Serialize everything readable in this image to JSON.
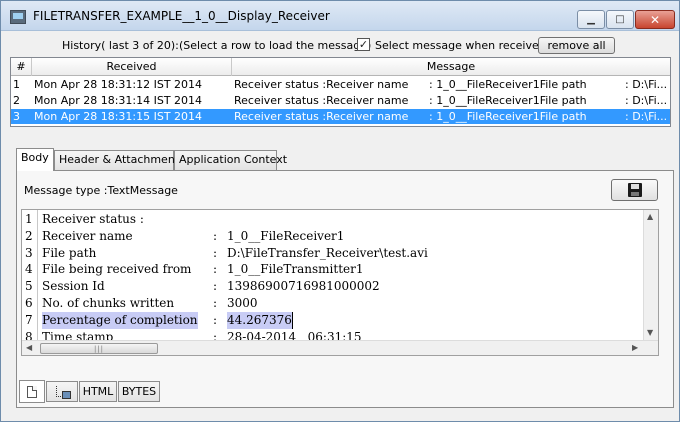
{
  "window": {
    "title": "FILETRANSFER_EXAMPLE__1_0__Display_Receiver",
    "controls": {
      "minimize": "▁",
      "maximize": "□",
      "close": "✕"
    }
  },
  "history": {
    "label": "History( last 3 of 20):",
    "hint": "(Select a row to load the message)",
    "checkbox_checked": true,
    "checkbox_mark": "✓",
    "checkbox_label": "Select message when received",
    "remove_all_label": "remove all"
  },
  "table": {
    "columns": [
      "#",
      "Received",
      "Message"
    ],
    "rows": [
      {
        "num": "1",
        "received": "Mon Apr 28 18:31:12 IST 2014",
        "m1": "Receiver status :Receiver name",
        "m2": ": 1_0__FileReceiver1File path",
        "m3": ": D:\\Fi...",
        "selected": false
      },
      {
        "num": "2",
        "received": "Mon Apr 28 18:31:14 IST 2014",
        "m1": "Receiver status :Receiver name",
        "m2": ": 1_0__FileReceiver1File path",
        "m3": ": D:\\Fi...",
        "selected": false
      },
      {
        "num": "3",
        "received": "Mon Apr 28 18:31:15 IST 2014",
        "m1": "Receiver status :Receiver name",
        "m2": ": 1_0__FileReceiver1File path",
        "m3": ": D:\\Fi...",
        "selected": true
      }
    ],
    "selected_color": "#3399ff"
  },
  "tabs": [
    "Body",
    "Header & Attachments",
    "Application Context"
  ],
  "body": {
    "message_type": "Message type :TextMessage",
    "save_icon": "floppy-disk-icon",
    "lines": [
      {
        "n": "1",
        "key": "Receiver status :",
        "colon": "",
        "value": ""
      },
      {
        "n": "2",
        "key": "Receiver name",
        "colon": ":",
        "value": "1_0__FileReceiver1"
      },
      {
        "n": "3",
        "key": "File path",
        "colon": ":",
        "value": "D:\\FileTransfer_Receiver\\test.avi"
      },
      {
        "n": "4",
        "key": "File being received from",
        "colon": ":",
        "value": "1_0__FileTransmitter1"
      },
      {
        "n": "5",
        "key": "Session Id",
        "colon": ":",
        "value": "13986900716981000002"
      },
      {
        "n": "6",
        "key": "No. of chunks written",
        "colon": ":",
        "value": "3000"
      },
      {
        "n": "7",
        "key": "Percentage of completion",
        "colon": ":",
        "value": "44.267376",
        "highlight": true
      },
      {
        "n": "8",
        "key": "Time stamp",
        "colon": ":",
        "value": "28-04-2014   06:31:15"
      }
    ],
    "highlight_color": "#c8ccf5"
  },
  "view_tabs": {
    "html": "HTML",
    "bytes": "BYTES"
  },
  "scroll_glyphs": {
    "up": "▲",
    "down": "▼",
    "left": "◀",
    "right": "▶",
    "grip": "|||"
  }
}
